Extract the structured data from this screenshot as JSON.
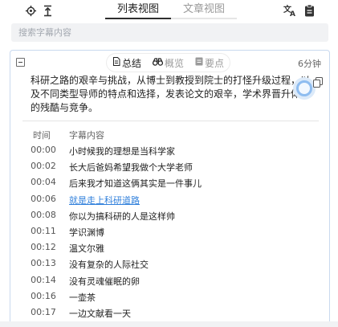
{
  "toolbar": {
    "locate_icon": "crosshair-icon",
    "scroll_top_icon": "scroll-to-top-icon",
    "translate_icon": "translate-icon",
    "clipboard_icon": "clipboard-icon"
  },
  "tabs": [
    {
      "label": "列表视图",
      "active": true
    },
    {
      "label": "文章视图",
      "active": false
    }
  ],
  "search": {
    "placeholder": "搜索字幕内容"
  },
  "panel": {
    "subtabs": [
      {
        "label": "总结",
        "icon": "document-icon",
        "active": true
      },
      {
        "label": "概览",
        "icon": "binoculars-icon",
        "active": false
      },
      {
        "label": "要点",
        "icon": "notes-icon",
        "active": false
      }
    ],
    "duration": "6分钟",
    "summary": "科研之路的艰辛与挑战，从博士到教授到院士的打怪升级过程，以及不同类型导师的特点和选择，发表论文的艰辛，学术界晋升体系的残酷与竞争。",
    "table_headers": {
      "time": "时间",
      "content": "字幕内容"
    },
    "rows": [
      {
        "time": "00:00",
        "text": "小时候我的理想是当科学家",
        "highlight": false
      },
      {
        "time": "00:02",
        "text": "长大后爸妈希望我做个大学老师",
        "highlight": false
      },
      {
        "time": "00:04",
        "text": "后来我才知道这俩其实是一件事儿",
        "highlight": false
      },
      {
        "time": "00:06",
        "text": "就是走上科研道路",
        "highlight": true
      },
      {
        "time": "00:08",
        "text": "你以为搞科研的人是这样帅",
        "highlight": false
      },
      {
        "time": "00:11",
        "text": "学识渊博",
        "highlight": false
      },
      {
        "time": "00:12",
        "text": "温文尔雅",
        "highlight": false
      },
      {
        "time": "00:13",
        "text": "没有复杂的人际社交",
        "highlight": false
      },
      {
        "time": "00:14",
        "text": "没有灵魂催眠的卵",
        "highlight": false
      },
      {
        "time": "00:16",
        "text": "一壶茶",
        "highlight": false
      },
      {
        "time": "00:17",
        "text": "一边文献看一天",
        "highlight": false
      }
    ]
  },
  "colors": {
    "accent": "#2f7fdb",
    "panel_border": "#c9d9ef",
    "search_bg": "#f1f2f4"
  }
}
